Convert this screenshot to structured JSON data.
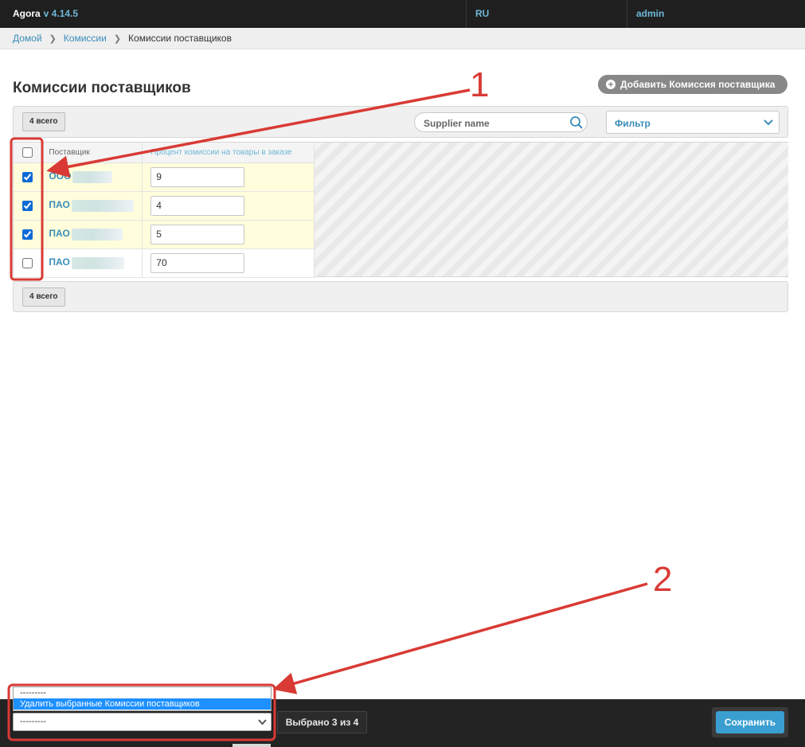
{
  "app": {
    "name": "Agora",
    "version": "v 4.14.5",
    "language": "RU",
    "user": "admin"
  },
  "breadcrumbs": {
    "home": "Домой",
    "section": "Комиссии",
    "current": "Комиссии поставщиков"
  },
  "page": {
    "title": "Комиссии поставщиков",
    "add_button": "Добавить Комиссия поставщика"
  },
  "toolbar": {
    "count_label": "4 всего",
    "search_placeholder": "Supplier name",
    "filter_label": "Фильтр"
  },
  "table": {
    "columns": {
      "supplier": "Поставщик",
      "percent": "Процент комиссии на товары в заказе"
    },
    "rows": [
      {
        "supplier_prefix": "ООО",
        "percent": "9",
        "checked": true
      },
      {
        "supplier_prefix": "ПАО",
        "percent": "4",
        "checked": true
      },
      {
        "supplier_prefix": "ПАО",
        "percent": "5",
        "checked": true
      },
      {
        "supplier_prefix": "ПАО",
        "percent": "70",
        "checked": false
      }
    ]
  },
  "footer_toolbar": {
    "count_label": "4 всего"
  },
  "actions": {
    "options": [
      "---------",
      "Удалить выбранные Комиссии поставщиков"
    ],
    "selected_value": "---------",
    "selected_count": "Выбрано 3 из 4",
    "save_button": "Сохранить"
  },
  "annotations": {
    "callout_1": "1",
    "callout_2": "2",
    "color": "#d93a35"
  },
  "colors": {
    "link": "#3a8cb8",
    "selected_row": "#fffddb",
    "save": "#3a9fd0",
    "topbar": "#1f1f1f"
  }
}
